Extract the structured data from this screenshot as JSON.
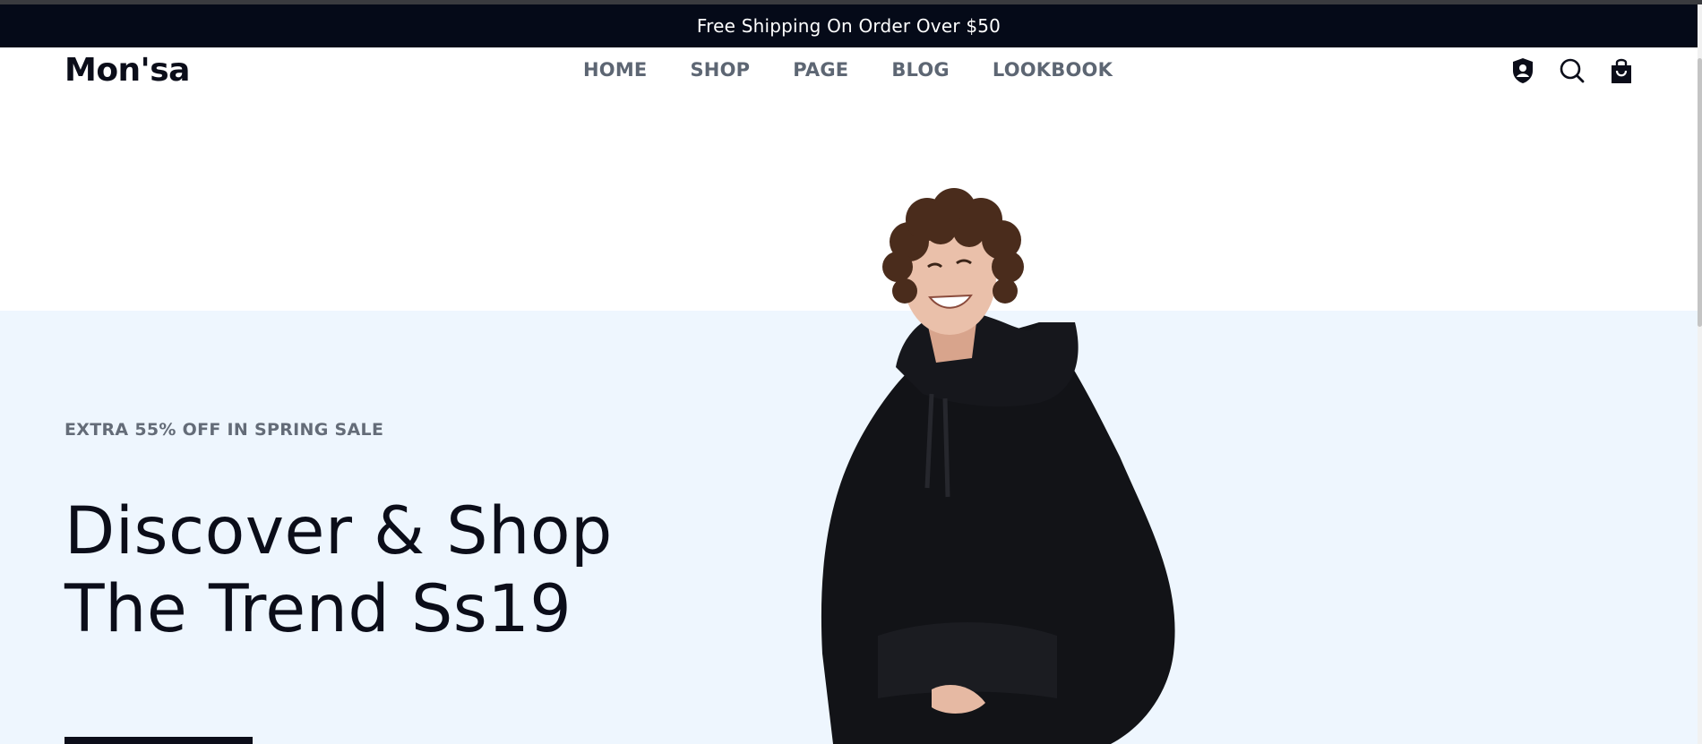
{
  "announcement": {
    "text": "Free Shipping On Order Over $50"
  },
  "header": {
    "logo": "Mon'sa",
    "nav": [
      {
        "label": "HOME"
      },
      {
        "label": "SHOP"
      },
      {
        "label": "PAGE"
      },
      {
        "label": "BLOG"
      },
      {
        "label": "LOOKBOOK"
      }
    ],
    "icons": [
      "account-shield-icon",
      "search-icon",
      "shopping-bag-icon"
    ]
  },
  "hero": {
    "subtitle": "EXTRA 55% OFF IN SPRING SALE",
    "title_line1": "Discover & Shop",
    "title_line2": "The Trend Ss19",
    "background_color": "#eef6fe"
  },
  "colors": {
    "announcement_bg": "#050a18",
    "text_dark": "#0b0d19",
    "nav_text": "#5d6673"
  }
}
